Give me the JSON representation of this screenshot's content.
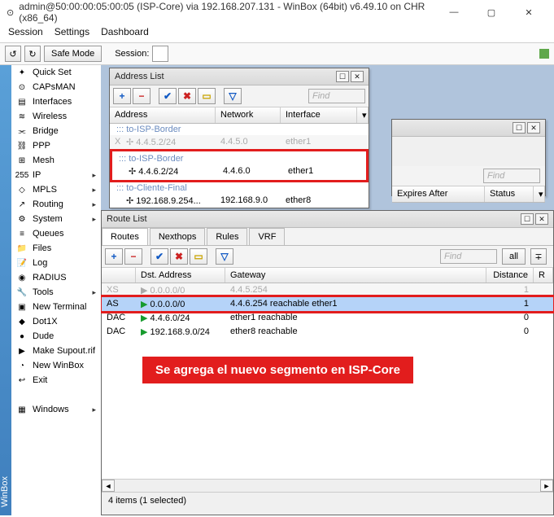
{
  "window": {
    "title": "admin@50:00:00:05:00:05 (ISP-Core) via 192.168.207.131 - WinBox (64bit) v6.49.10 on CHR (x86_64)"
  },
  "menubar": {
    "session": "Session",
    "settings": "Settings",
    "dashboard": "Dashboard"
  },
  "toolbar": {
    "safe_mode": "Safe Mode",
    "session_label": "Session:"
  },
  "sidebar": {
    "items": [
      {
        "label": "Quick Set",
        "icon": "✦",
        "submenu": false
      },
      {
        "label": "CAPsMAN",
        "icon": "⊙",
        "submenu": false
      },
      {
        "label": "Interfaces",
        "icon": "▤",
        "submenu": false
      },
      {
        "label": "Wireless",
        "icon": "≋",
        "submenu": false
      },
      {
        "label": "Bridge",
        "icon": "⫘",
        "submenu": false
      },
      {
        "label": "PPP",
        "icon": "⛓",
        "submenu": false
      },
      {
        "label": "Mesh",
        "icon": "⊞",
        "submenu": false
      },
      {
        "label": "IP",
        "icon": "255",
        "submenu": true
      },
      {
        "label": "MPLS",
        "icon": "◇",
        "submenu": true
      },
      {
        "label": "Routing",
        "icon": "↗",
        "submenu": true
      },
      {
        "label": "System",
        "icon": "⚙",
        "submenu": true
      },
      {
        "label": "Queues",
        "icon": "≡",
        "submenu": false
      },
      {
        "label": "Files",
        "icon": "📁",
        "submenu": false
      },
      {
        "label": "Log",
        "icon": "📝",
        "submenu": false
      },
      {
        "label": "RADIUS",
        "icon": "◉",
        "submenu": false
      },
      {
        "label": "Tools",
        "icon": "🔧",
        "submenu": true
      },
      {
        "label": "New Terminal",
        "icon": "▣",
        "submenu": false
      },
      {
        "label": "Dot1X",
        "icon": "◆",
        "submenu": false
      },
      {
        "label": "Dude",
        "icon": "●",
        "submenu": false
      },
      {
        "label": "Make Supout.rif",
        "icon": "▶",
        "submenu": false
      },
      {
        "label": "New WinBox",
        "icon": "◔",
        "submenu": false
      },
      {
        "label": "Exit",
        "icon": "↩",
        "submenu": false
      },
      {
        "label": "",
        "icon": "",
        "submenu": false
      },
      {
        "label": "Windows",
        "icon": "▦",
        "submenu": true
      }
    ],
    "tag": "WinBox"
  },
  "address_list": {
    "title": "Address List",
    "find_placeholder": "Find",
    "columns": {
      "address": "Address",
      "network": "Network",
      "interface": "Interface"
    },
    "groups": [
      {
        "name": "::: to-ISP-Border",
        "rows": [
          {
            "flag": "X",
            "address": "4.4.5.2/24",
            "network": "4.4.5.0",
            "iface": "ether1",
            "disabled": true
          }
        ]
      },
      {
        "name": "::: to-ISP-Border",
        "highlight": true,
        "rows": [
          {
            "flag": "",
            "address": "4.4.6.2/24",
            "network": "4.4.6.0",
            "iface": "ether1",
            "disabled": false
          }
        ]
      },
      {
        "name": "::: to-Cliente-Final",
        "rows": [
          {
            "flag": "",
            "address": "192.168.9.254...",
            "network": "192.168.9.0",
            "iface": "ether8",
            "disabled": false
          }
        ]
      }
    ]
  },
  "hidden_panel": {
    "find_placeholder": "Find",
    "col1": "Expires After",
    "col2": "Status"
  },
  "route_list": {
    "title": "Route List",
    "tabs": {
      "routes": "Routes",
      "nexthops": "Nexthops",
      "rules": "Rules",
      "vrf": "VRF"
    },
    "find_placeholder": "Find",
    "all": "all",
    "columns": {
      "dst": "Dst. Address",
      "gateway": "Gateway",
      "distance": "Distance",
      "r": "R"
    },
    "rows": [
      {
        "flag": "XS",
        "dst": "0.0.0.0/0",
        "gw": "4.4.5.254",
        "dist": "1",
        "disabled": true
      },
      {
        "flag": "AS",
        "dst": "0.0.0.0/0",
        "gw": "4.4.6.254 reachable ether1",
        "dist": "1",
        "selected": true,
        "highlight": true
      },
      {
        "flag": "DAC",
        "dst": "4.4.6.0/24",
        "gw": "ether1 reachable",
        "dist": "0"
      },
      {
        "flag": "DAC",
        "dst": "192.168.9.0/24",
        "gw": "ether8 reachable",
        "dist": "0"
      }
    ],
    "annotation": "Se agrega el nuevo segmento en ISP-Core",
    "status": "4 items (1 selected)"
  }
}
